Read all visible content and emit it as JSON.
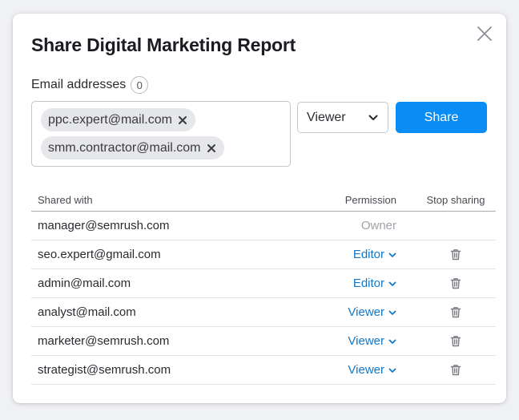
{
  "dialog": {
    "title": "Share Digital Marketing Report",
    "email_label": "Email addresses",
    "email_count": "0",
    "chips": [
      "ppc.expert@mail.com",
      "smm.contractor@mail.com"
    ],
    "role_select": "Viewer",
    "share_label": "Share"
  },
  "table": {
    "headers": {
      "email": "Shared with",
      "permission": "Permission",
      "stop": "Stop sharing"
    },
    "rows": [
      {
        "email": "manager@semrush.com",
        "permission": "Owner"
      },
      {
        "email": "seo.expert@gmail.com",
        "permission": "Editor"
      },
      {
        "email": "admin@mail.com",
        "permission": "Editor"
      },
      {
        "email": "analyst@mail.com",
        "permission": "Viewer"
      },
      {
        "email": "marketer@semrush.com",
        "permission": "Viewer"
      },
      {
        "email": "strategist@semrush.com",
        "permission": "Viewer"
      }
    ]
  },
  "icons": {
    "close": "close-icon",
    "chip_remove": "close-icon",
    "dropdown": "chevron-down-icon",
    "delete": "trash-icon"
  },
  "colors": {
    "primary_button": "#0a8cf5",
    "link": "#1277c8",
    "owner_text": "#a0a2a8"
  }
}
